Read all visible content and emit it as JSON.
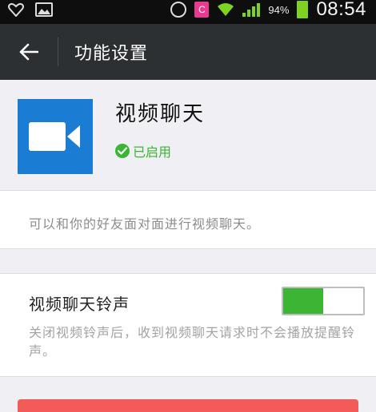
{
  "status_bar": {
    "battery_percent": "94%",
    "time": "08:54",
    "app_badge": "C",
    "icons": [
      "heart-outline-icon",
      "gallery-icon",
      "alarm-icon",
      "app-badge-icon",
      "wifi-icon",
      "signal-icon",
      "battery-icon"
    ]
  },
  "action_bar": {
    "title": "功能设置",
    "back_icon": "arrow-left-icon"
  },
  "feature": {
    "name": "视频聊天",
    "status": "已启用",
    "icon": "video-camera-icon",
    "description": "可以和你的好友面对面进行视频聊天。"
  },
  "ringtone": {
    "title": "视频聊天铃声",
    "description": "关闭视频铃声后，收到视频聊天请求时不会播放提醒铃声。",
    "enabled": true,
    "toggle_level": 0.5
  },
  "colors": {
    "accent_green": "#3cb534",
    "action_bar": "#2d3032",
    "app_icon_blue": "#1b7cd4",
    "danger_red": "#f35a5a"
  }
}
